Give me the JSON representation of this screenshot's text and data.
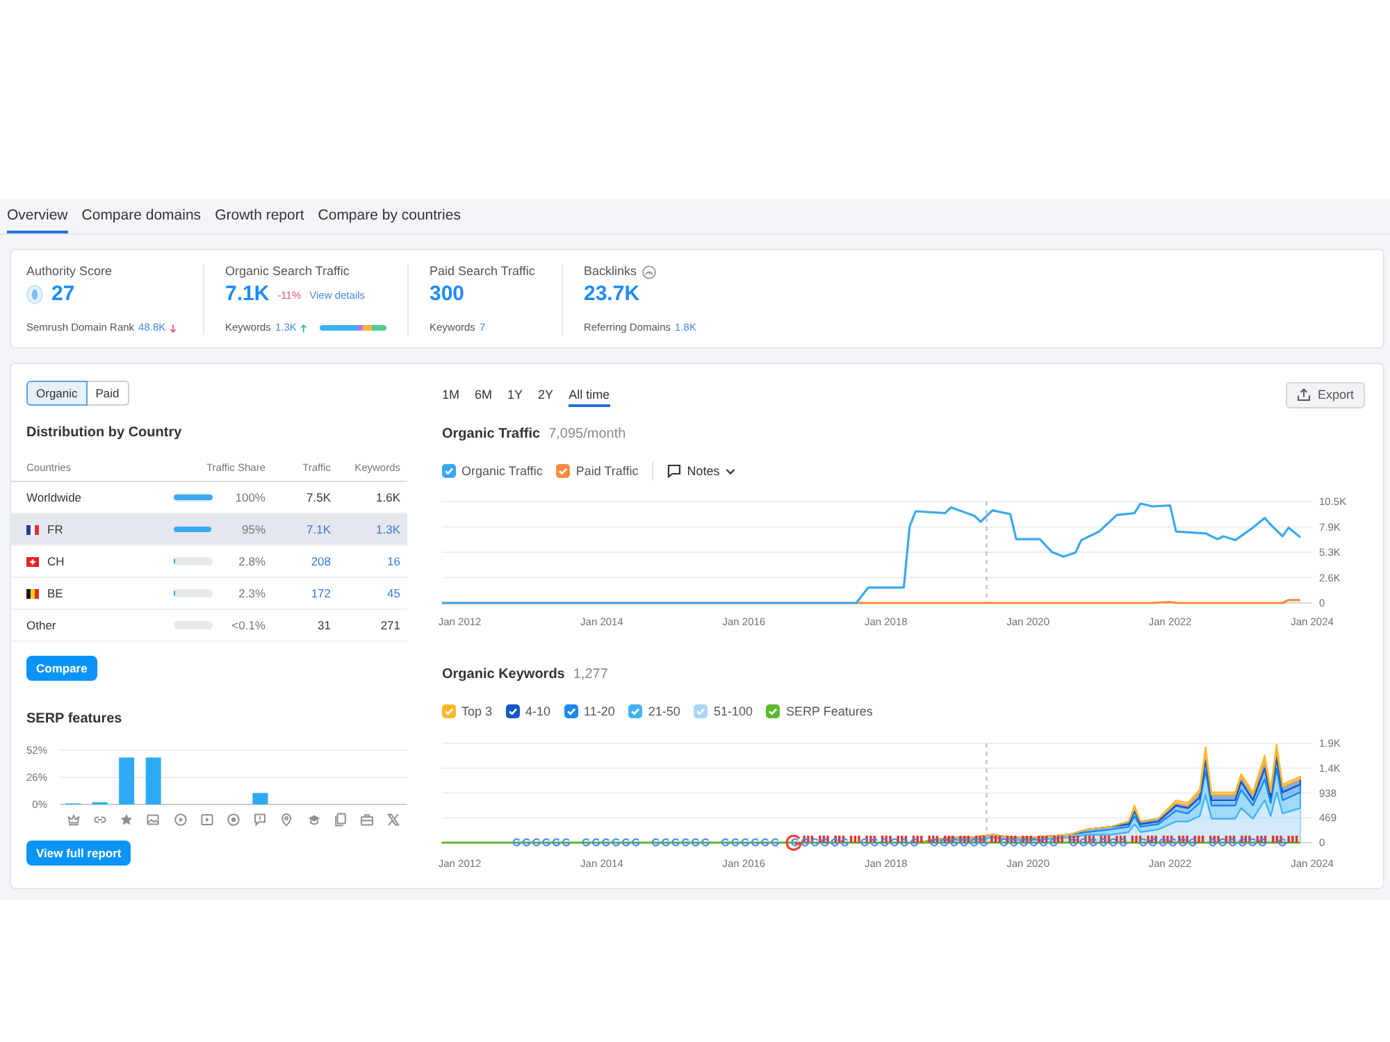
{
  "tabs": [
    {
      "label": "Overview",
      "selected": true
    },
    {
      "label": "Compare domains",
      "selected": false
    },
    {
      "label": "Growth report",
      "selected": false
    },
    {
      "label": "Compare by countries",
      "selected": false
    }
  ],
  "metrics": [
    {
      "kind": "authority",
      "title": "Authority Score",
      "value": "27",
      "footer_label": "Semrush Domain Rank",
      "footer_value": "48.8K",
      "arrow": {
        "kind": "down"
      }
    },
    {
      "kind": "traffic",
      "title": "Organic Search Traffic",
      "value": "7.1K",
      "change": "-11%",
      "link": "View details",
      "footer_label": "Keywords",
      "footer_value": "1.3K",
      "arrow": {
        "kind": "up"
      }
    },
    {
      "kind": "plain",
      "title": "Paid Search Traffic",
      "value": "300",
      "footer_label": "Keywords",
      "footer_value": "7"
    },
    {
      "kind": "gauge",
      "title": "Backlinks",
      "value": "23.7K",
      "footer_label": "Referring Domains",
      "footer_value": "1.8K"
    }
  ],
  "main": {
    "segments": [
      {
        "label": "Organic",
        "selected": true
      },
      {
        "label": "Paid",
        "selected": false
      }
    ],
    "distribution": {
      "title": "Distribution by Country",
      "columns": [
        "Countries",
        "Traffic Share",
        "Traffic",
        "Keywords"
      ],
      "rows": [
        {
          "name": "Worldwide",
          "kind": "aggregate",
          "level": 1,
          "share": "100%",
          "traffic": "7.5K",
          "keywords": "1.6K",
          "selected": false
        },
        {
          "name": "FR",
          "kind": "country",
          "flag": {
            "kind": "tricolor",
            "parts": [
              {
                "color": "#1f3f9a"
              },
              {
                "color": "#ffffff"
              },
              {
                "color": "#e63232"
              }
            ]
          },
          "level": 0.95,
          "share": "95%",
          "traffic": "7.1K",
          "keywords": "1.3K",
          "selected": true
        },
        {
          "name": "CH",
          "kind": "country",
          "flag": {
            "kind": "cross",
            "parts": [
              {
                "color": "#ea2027"
              },
              {
                "color": "#ffffff"
              }
            ]
          },
          "level": 0.028,
          "share": "2.8%",
          "traffic": "208",
          "keywords": "16",
          "selected": false
        },
        {
          "name": "BE",
          "kind": "country",
          "flag": {
            "kind": "tricolor",
            "parts": [
              {
                "color": "#1a1a1a"
              },
              {
                "color": "#f7d117"
              },
              {
                "color": "#e52b2b"
              }
            ]
          },
          "level": 0.023,
          "share": "2.3%",
          "traffic": "172",
          "keywords": "45",
          "selected": false
        },
        {
          "name": "Other",
          "kind": "aggregate",
          "level": 0.001,
          "share": "<0.1%",
          "traffic": "31",
          "keywords": "271",
          "selected": false
        }
      ]
    },
    "compare_button": "Compare",
    "serp": {
      "chart_data": {
        "type": "bar",
        "title": "SERP features",
        "categories": [
          null,
          null,
          null,
          null,
          null,
          null,
          null,
          null,
          null,
          null,
          null,
          null,
          null
        ],
        "values": [
          1,
          2,
          45,
          45,
          0,
          0,
          0,
          11,
          0,
          0,
          0,
          0,
          0
        ],
        "color": "#2eaaf5",
        "ylim": [
          0,
          52
        ],
        "yticks": [
          {
            "value": 0,
            "label": "0%"
          },
          {
            "value": 26,
            "label": "26%"
          },
          {
            "value": 52,
            "label": "52%"
          }
        ],
        "grid": true
      },
      "button": "View full report"
    },
    "periods": [
      {
        "label": "1M",
        "selected": false
      },
      {
        "label": "6M",
        "selected": false
      },
      {
        "label": "1Y",
        "selected": false
      },
      {
        "label": "2Y",
        "selected": false
      },
      {
        "label": "All time",
        "selected": true
      }
    ],
    "export_button": "Export",
    "traffic": {
      "legend_items": [
        {
          "checked": true
        },
        {
          "checked": true
        }
      ],
      "notes": "Notes",
      "chart_data": {
        "type": "line",
        "title": "Organic Traffic",
        "subtitle": "7,095/month",
        "grid": true,
        "x": [
          "2011-10-01",
          "2017-08-01",
          "2017-10-01",
          "2018-04-01",
          "2018-05-01",
          "2018-06-01",
          "2018-11-01",
          "2018-12-01",
          "2019-04-01",
          "2019-05-01",
          "2019-07-01",
          "2019-10-01",
          "2019-11-01",
          "2020-03-01",
          "2020-05-01",
          "2020-07-01",
          "2020-09-01",
          "2020-10-01",
          "2021-01-01",
          "2021-04-01",
          "2021-07-01",
          "2021-08-01",
          "2021-10-01",
          "2022-01-01",
          "2022-02-01",
          "2022-07-01",
          "2022-09-01",
          "2022-10-01",
          "2022-12-01",
          "2023-03-01",
          "2023-05-01",
          "2023-06-01",
          "2023-08-01",
          "2023-09-01",
          "2023-11-01"
        ],
        "series": [
          {
            "name": "Organic Traffic",
            "color": "#3aa8f2",
            "values": [
              0,
              0,
              1600,
              1600,
              7900,
              9500,
              9300,
              9900,
              9000,
              8400,
              9600,
              9200,
              6600,
              6600,
              5300,
              4800,
              5200,
              6500,
              7400,
              9100,
              9300,
              10300,
              10000,
              10100,
              7400,
              7200,
              6600,
              6900,
              6500,
              7800,
              8800,
              8100,
              6900,
              7800,
              6800
            ]
          },
          {
            "name": "Paid Traffic",
            "color": "#ff8a3d",
            "values": [
              0,
              0,
              0,
              0,
              0,
              0,
              0,
              0,
              0,
              0,
              0,
              0,
              0,
              0,
              0,
              0,
              0,
              0,
              0,
              0,
              0,
              0,
              0,
              100,
              0,
              0,
              0,
              0,
              0,
              0,
              0,
              0,
              0,
              300,
              300
            ]
          }
        ],
        "xlim": [
          "2011-10-01",
          "2024-01-01"
        ],
        "ylim": [
          0,
          10500
        ],
        "xticks": [
          {
            "value": "2012-01-01",
            "label": "Jan 2012"
          },
          {
            "value": "2014-01-01",
            "label": "Jan 2014"
          },
          {
            "value": "2016-01-01",
            "label": "Jan 2016"
          },
          {
            "value": "2018-01-01",
            "label": "Jan 2018"
          },
          {
            "value": "2020-01-01",
            "label": "Jan 2020"
          },
          {
            "value": "2022-01-01",
            "label": "Jan 2022"
          },
          {
            "value": "2024-01-01",
            "label": "Jan 2024"
          }
        ],
        "yticks": [
          0,
          {
            "value": 2625,
            "label": "2.6K"
          },
          {
            "value": 5250,
            "label": "5.3K"
          },
          {
            "value": 7875,
            "label": "7.9K"
          },
          {
            "value": 10500,
            "label": "10.5K"
          }
        ],
        "ref_lines": [
          {
            "axis": "x",
            "value": "2019-06-01",
            "line_style": "dashed",
            "color": "#b4b8bf"
          }
        ]
      }
    },
    "keywords": {
      "legend_items": [
        {
          "checked": true
        },
        {
          "checked": true
        },
        {
          "checked": true
        },
        {
          "checked": true
        },
        {
          "checked": true
        },
        {
          "checked": true
        }
      ],
      "chart_data": {
        "type": "area",
        "stacked": true,
        "title": "Organic Keywords",
        "subtitle": "1,277",
        "grid": true,
        "x": [
          "2011-10-01",
          "2018-06-01",
          "2018-09-01",
          "2018-12-01",
          "2019-04-01",
          "2019-07-01",
          "2019-10-01",
          "2020-02-01",
          "2020-08-01",
          "2020-11-01",
          "2021-03-01",
          "2021-06-01",
          "2021-07-01",
          "2021-08-01",
          "2021-11-01",
          "2022-02-01",
          "2022-04-01",
          "2022-06-01",
          "2022-07-01",
          "2022-08-01",
          "2022-12-01",
          "2023-01-01",
          "2023-03-01",
          "2023-05-01",
          "2023-06-01",
          "2023-07-01",
          "2023-08-01",
          "2023-11-01"
        ],
        "series": [
          {
            "name": "Top 3",
            "color": "#ffb62e",
            "values": [
              0,
              0,
              0,
              0,
              0,
              0,
              0,
              0,
              0,
              0,
              0,
              0,
              50,
              0,
              0,
              50,
              50,
              50,
              100,
              50,
              50,
              50,
              50,
              100,
              50,
              100,
              50,
              50
            ]
          },
          {
            "name": "4-10",
            "color": "#1257c7",
            "values": [
              0,
              0,
              0,
              0,
              0,
              0,
              0,
              0,
              0,
              0,
              0,
              50,
              50,
              50,
              50,
              50,
              50,
              100,
              150,
              100,
              100,
              100,
              100,
              150,
              100,
              150,
              100,
              100
            ]
          },
          {
            "name": "11-20",
            "color": "#1e88f0",
            "values": [
              0,
              0,
              0,
              0,
              0,
              0,
              0,
              0,
              0,
              50,
              50,
              50,
              100,
              50,
              50,
              100,
              100,
              100,
              200,
              100,
              100,
              150,
              100,
              200,
              100,
              200,
              150,
              150
            ]
          },
          {
            "name": "21-50",
            "color": "#41b3f5",
            "values": [
              0,
              0,
              0,
              50,
              50,
              50,
              50,
              50,
              50,
              50,
              100,
              100,
              150,
              100,
              100,
              200,
              150,
              250,
              450,
              250,
              250,
              350,
              250,
              400,
              250,
              450,
              250,
              300
            ]
          },
          {
            "name": "51-100",
            "color": "#a6d6fa",
            "values": [
              0,
              0,
              50,
              50,
              50,
              100,
              50,
              50,
              100,
              150,
              150,
              200,
              350,
              200,
              250,
              400,
              400,
              500,
              900,
              450,
              450,
              650,
              450,
              800,
              500,
              950,
              550,
              650
            ]
          },
          {
            "name": "SERP Features",
            "type": "line",
            "color": "#5aba2f",
            "values": [
              0,
              0,
              0,
              0,
              0,
              0,
              0,
              0,
              0,
              0,
              0,
              0,
              0,
              0,
              0,
              0,
              0,
              0,
              0,
              0,
              0,
              0,
              0,
              0,
              0,
              0,
              0,
              0
            ]
          }
        ],
        "xlim": [
          "2011-10-01",
          "2024-01-01"
        ],
        "ylim": [
          0,
          1876
        ],
        "xticks": [
          {
            "value": "2012-01-01",
            "label": "Jan 2012"
          },
          {
            "value": "2014-01-01",
            "label": "Jan 2014"
          },
          {
            "value": "2016-01-01",
            "label": "Jan 2016"
          },
          {
            "value": "2018-01-01",
            "label": "Jan 2018"
          },
          {
            "value": "2020-01-01",
            "label": "Jan 2020"
          },
          {
            "value": "2022-01-01",
            "label": "Jan 2022"
          },
          {
            "value": "2024-01-01",
            "label": "Jan 2024"
          }
        ],
        "yticks": [
          0,
          469,
          938,
          {
            "value": 1407,
            "label": "1.4K"
          },
          {
            "value": 1876,
            "label": "1.9K"
          }
        ],
        "ref_lines": [
          {
            "axis": "x",
            "value": "2019-06-01",
            "line_style": "dashed",
            "color": "#b4b8bf"
          }
        ]
      }
    }
  }
}
